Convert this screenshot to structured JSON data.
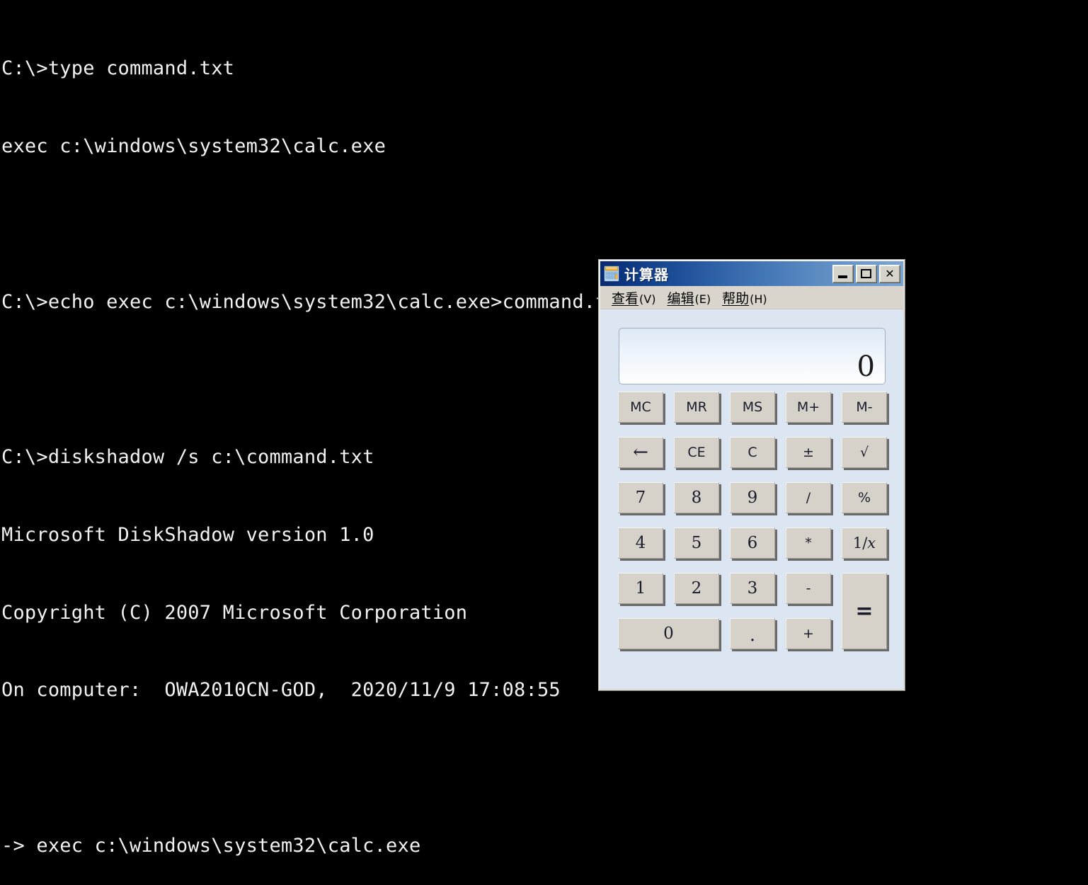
{
  "theme": {
    "console_bg": "#000000",
    "console_fg": "#f2f2f2",
    "window_client_bg": "#dce6f2",
    "titlebar_left": "#0a2a6e",
    "titlebar_right": "#7aa4d2",
    "menubar_bg": "#d9d5cd",
    "key_face": "#d6d2c9",
    "key_shadow": "#6b6b6b",
    "key_text": "#1b1b2e"
  },
  "console": {
    "lines": [
      "C:\\>type command.txt",
      "exec c:\\windows\\system32\\calc.exe",
      "",
      "C:\\>echo exec c:\\windows\\system32\\calc.exe>command.txt",
      "",
      "C:\\>diskshadow /s c:\\command.txt",
      "Microsoft DiskShadow version 1.0",
      "Copyright (C) 2007 Microsoft Corporation",
      "On computer:  OWA2010CN-GOD,  2020/11/9 17:08:55",
      "",
      "-> exec c:\\windows\\system32\\calc.exe"
    ]
  },
  "calculator": {
    "title": "计算器",
    "icon": "calculator-icon",
    "window_buttons": [
      {
        "name": "minimize",
        "label": "",
        "icon": "minimize-icon"
      },
      {
        "name": "maximize",
        "label": "",
        "icon": "maximize-icon"
      },
      {
        "name": "close",
        "label": "✕",
        "icon": "close-icon"
      }
    ],
    "menu": [
      {
        "main": "查看",
        "key": "(V)"
      },
      {
        "main": "编辑",
        "key": "(E)"
      },
      {
        "main": "帮助",
        "key": "(H)"
      }
    ],
    "display": {
      "value": "0"
    },
    "keys": {
      "memory": [
        "MC",
        "MR",
        "MS",
        "M+",
        "M-"
      ],
      "edit": [
        "←",
        "CE",
        "C",
        "±",
        "√"
      ],
      "row7": [
        "7",
        "8",
        "9",
        "/",
        "%"
      ],
      "row4": [
        "4",
        "5",
        "6",
        "*",
        "1/x"
      ],
      "row1": [
        "1",
        "2",
        "3",
        "-"
      ],
      "row0": [
        "0",
        ".",
        "+"
      ],
      "equals": "="
    }
  }
}
